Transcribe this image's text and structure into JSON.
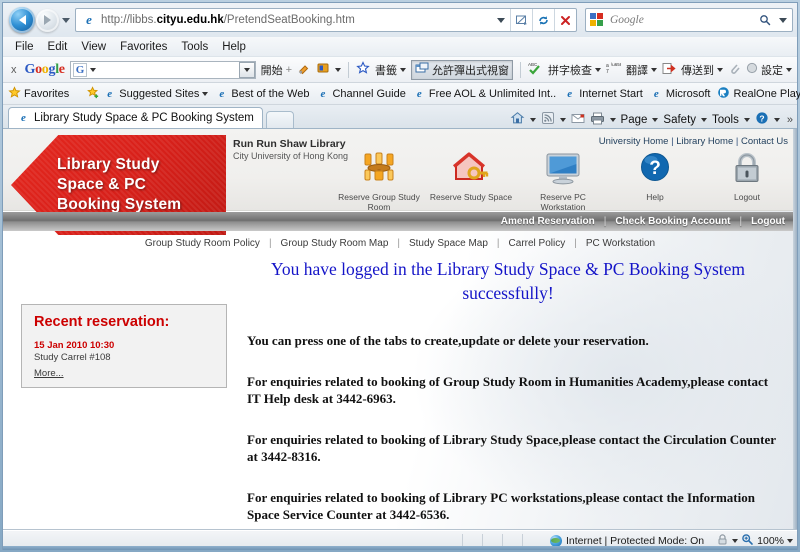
{
  "browser": {
    "address": {
      "url_prefix": "http://libbs.",
      "url_domain": "cityu.edu.hk",
      "url_suffix": "/PretendSeatBooking.htm",
      "full_url": "http://libbs.cityu.edu.hk/PretendSeatBooking.htm"
    },
    "search": {
      "placeholder": "Google"
    },
    "menu": [
      "File",
      "Edit",
      "View",
      "Favorites",
      "Tools",
      "Help"
    ],
    "google_toolbar": {
      "close_label": "x",
      "logo": {
        "g1": "G",
        "o1": "o",
        "o2": "o",
        "g2": "g",
        "l": "l",
        "e": "e"
      },
      "search_value": "",
      "items": [
        {
          "label": "開始",
          "icon": "start-icon"
        },
        {
          "label": "書籤",
          "icon": "bookmark-star-icon"
        },
        {
          "label": "允許彈出式視窗",
          "icon": "popup-blocker-icon",
          "pressed": true
        },
        {
          "label": "拼字檢查",
          "icon": "spellcheck-icon"
        },
        {
          "label": "翻譯",
          "icon": "translate-icon"
        },
        {
          "label": "傳送到",
          "icon": "sendto-icon"
        },
        {
          "label": "設定",
          "icon": "settings-icon"
        }
      ]
    },
    "favorites_bar": {
      "favorites_label": "Favorites",
      "items": [
        "Suggested Sites",
        "Best of the Web",
        "Channel Guide",
        "Free AOL & Unlimited Int..",
        "Internet Start",
        "Microsoft",
        "RealOne Player"
      ],
      "overflow": "»"
    },
    "tab": {
      "title": "Library Study Space & PC Booking System"
    },
    "command_bar": {
      "items": [
        "Page",
        "Safety",
        "Tools"
      ],
      "overflow": "»"
    },
    "status": {
      "zone": "Internet | Protected Mode: On",
      "zoom": "100%"
    }
  },
  "page": {
    "banner": {
      "line1": "Library Study",
      "line2": "Space & PC",
      "line3": "Booking System"
    },
    "library": {
      "name": "Run Run Shaw Library",
      "university": "City University of Hong Kong"
    },
    "top_links": [
      "University Home",
      "Library Home",
      "Contact Us"
    ],
    "icon_nav": [
      {
        "label": "Reserve Group Study Room",
        "icon": "group-study-room-icon"
      },
      {
        "label": "Reserve Study Space",
        "icon": "house-key-icon"
      },
      {
        "label": "Reserve PC Workstation",
        "icon": "monitor-icon"
      },
      {
        "label": "Help",
        "icon": "question-mark-icon"
      },
      {
        "label": "Logout",
        "icon": "padlock-icon"
      }
    ],
    "gray_nav": [
      "Amend Reservation",
      "Check Booking Account",
      "Logout"
    ],
    "policy_nav": [
      "Group Study Room Policy",
      "Group Study Room Map",
      "Study Space Map",
      "Carrel Policy",
      "PC Workstation"
    ],
    "headline": "You have logged in the Library Study Space & PC Booking System successfully!",
    "paragraphs": [
      "You can press one of the tabs to create,update or delete your reservation.",
      "For enquiries related to booking of Group Study Room in Humanities Academy,please contact IT Help desk at 3442-6963.",
      "For enquiries related to booking of Library Study Space,please contact the Circulation Counter at 3442-8316.",
      "For enquiries related to booking of Library PC workstations,please contact the Information Space Service Counter at 3442-6536."
    ],
    "sidebar": {
      "title": "Recent reservation:",
      "date": "15 Jan 2010   10:30",
      "description": "Study Carrel #108",
      "more": "More..."
    },
    "colors": {
      "brand_red": "#d8201a",
      "headline_blue": "#1414c8",
      "accent_red": "#cc0000"
    }
  }
}
